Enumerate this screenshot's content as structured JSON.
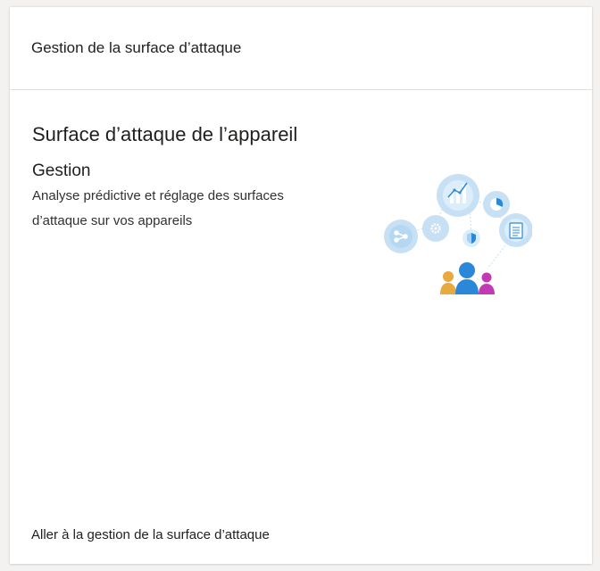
{
  "card": {
    "title": "Gestion de la surface d’attaque",
    "heading": "Surface d’attaque de l’appareil",
    "subheading": "Gestion",
    "description": "Analyse prédictive et réglage des surfaces d’attaque sur vos appareils",
    "link_label": "Aller à la gestion de la surface d’attaque"
  },
  "illustration": {
    "icons": [
      "share-nodes-icon",
      "gear-icon",
      "line-chart-icon",
      "pie-chart-icon",
      "shield-icon",
      "clipboard-icon",
      "people-icon"
    ],
    "colors": {
      "circle_fill": "#c7e0f4",
      "circle_inner": "#a9d0ef",
      "icon_blue": "#2b88d8",
      "person_center": "#0078d4",
      "person_left": "#e8a93e",
      "person_right": "#c239b3"
    }
  }
}
